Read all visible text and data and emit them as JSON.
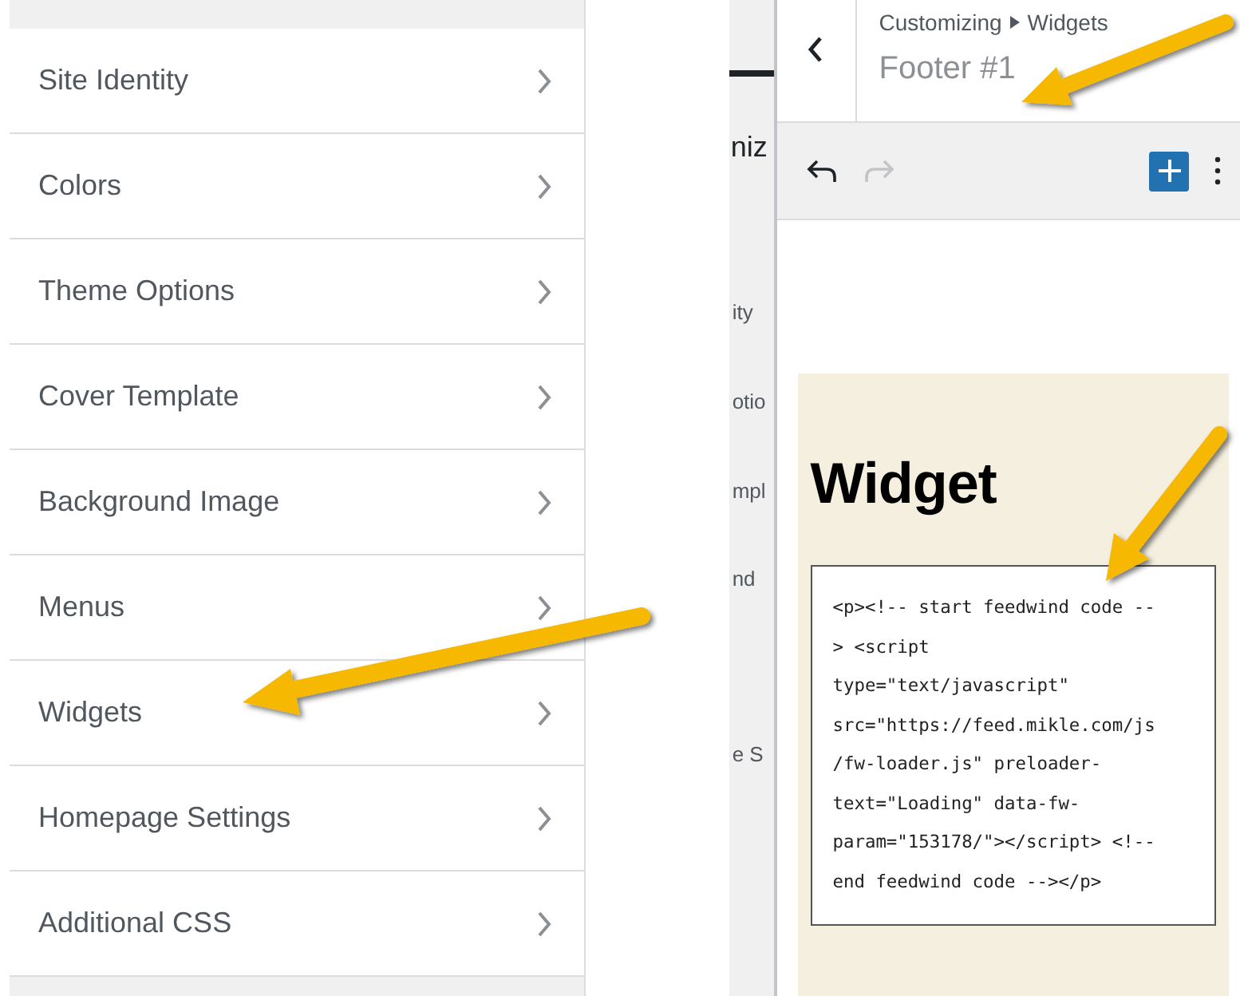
{
  "customizer_menu": {
    "items": [
      {
        "label": "Site Identity"
      },
      {
        "label": "Colors"
      },
      {
        "label": "Theme Options"
      },
      {
        "label": "Cover Template"
      },
      {
        "label": "Background Image"
      },
      {
        "label": "Menus"
      },
      {
        "label": "Widgets"
      },
      {
        "label": "Homepage Settings"
      },
      {
        "label": "Additional CSS"
      }
    ]
  },
  "background_panel": {
    "fragments": [
      {
        "text": "niz",
        "kind": "title"
      },
      {
        "text": "ity",
        "kind": "row"
      },
      {
        "text": "otio",
        "kind": "row"
      },
      {
        "text": "mpl",
        "kind": "row"
      },
      {
        "text": "nd",
        "kind": "row"
      },
      {
        "text": "e S",
        "kind": "row"
      }
    ]
  },
  "widget_panel": {
    "breadcrumb": {
      "parent": "Customizing",
      "current": "Widgets"
    },
    "title": "Footer #1",
    "toolbar": {
      "undo_disabled": false,
      "redo_disabled": true
    },
    "widget": {
      "heading": "Widget",
      "code_lines": [
        "<p><!-- start feedwind code --",
        "> <script",
        "type=\"text/javascript\"",
        "src=\"https://feed.mikle.com/js",
        "/fw-loader.js\" preloader-",
        "text=\"Loading\" data-fw-",
        "param=\"153178/\"></script> <!--",
        "end feedwind code --></p>"
      ]
    }
  }
}
